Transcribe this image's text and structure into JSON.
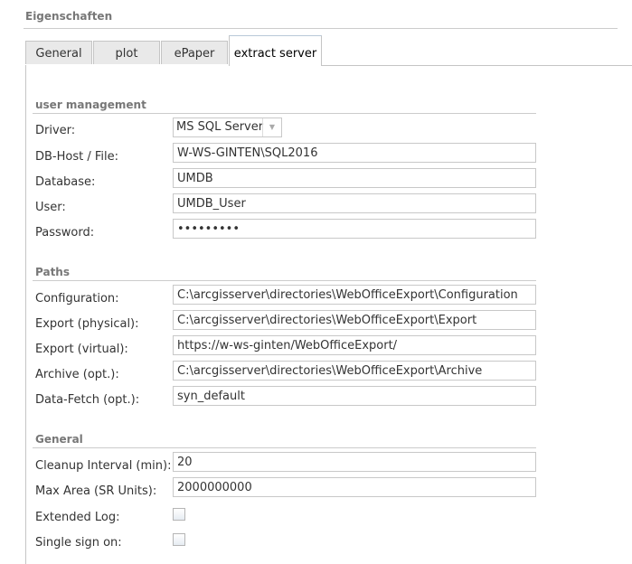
{
  "title": "Eigenschaften",
  "tabs": [
    {
      "label": "General"
    },
    {
      "label": "plot"
    },
    {
      "label": "ePaper"
    },
    {
      "label": "extract server",
      "active": true
    }
  ],
  "user_management": {
    "header": "user management",
    "driver": {
      "label": "Driver:",
      "value": "MS SQL Server"
    },
    "db_host": {
      "label": "DB-Host / File:",
      "value": "W-WS-GINTEN\\SQL2016"
    },
    "database": {
      "label": "Database:",
      "value": "UMDB"
    },
    "user": {
      "label": "User:",
      "value": "UMDB_User"
    },
    "password": {
      "label": "Password:",
      "value": "•••••••••"
    }
  },
  "paths": {
    "header": "Paths",
    "configuration": {
      "label": "Configuration:",
      "value": "C:\\arcgisserver\\directories\\WebOfficeExport\\Configuration"
    },
    "export_physical": {
      "label": "Export (physical):",
      "value": "C:\\arcgisserver\\directories\\WebOfficeExport\\Export"
    },
    "export_virtual": {
      "label": "Export (virtual):",
      "value": "https://w-ws-ginten/WebOfficeExport/"
    },
    "archive": {
      "label": "Archive (opt.):",
      "value": "C:\\arcgisserver\\directories\\WebOfficeExport\\Archive"
    },
    "data_fetch": {
      "label": "Data-Fetch (opt.):",
      "value": "syn_default"
    }
  },
  "general": {
    "header": "General",
    "cleanup": {
      "label": "Cleanup Interval (min):",
      "value": "20"
    },
    "max_area": {
      "label": "Max Area (SR Units):",
      "value": "2000000000"
    },
    "extended_log": {
      "label": "Extended Log:",
      "checked": false
    },
    "sso": {
      "label": "Single sign on:",
      "checked": false
    }
  }
}
